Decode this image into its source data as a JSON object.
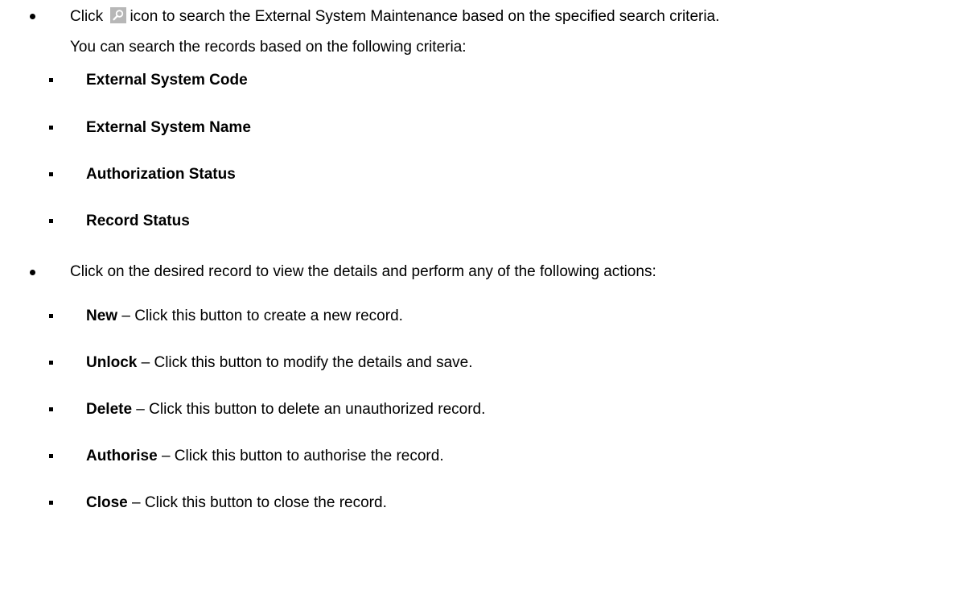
{
  "intro": {
    "click_word": "Click",
    "icon": "search-icon",
    "rest": "icon to search the External System Maintenance based on the specified search criteria.",
    "line2": "You can search the records based on the following criteria:"
  },
  "criteria": [
    "External System Code",
    "External System Name",
    "Authorization Status",
    "Record Status"
  ],
  "actions_intro": "Click on the desired record to view the details and perform any of the following actions:",
  "actions": [
    {
      "label": "New",
      "desc": " – Click this button to create a new record."
    },
    {
      "label": "Unlock",
      "desc": " – Click this button to modify the details and save."
    },
    {
      "label": "Delete",
      "desc": " – Click this button to delete an unauthorized record."
    },
    {
      "label": "Authorise",
      "desc": " – Click this button to authorise the record."
    },
    {
      "label": "Close",
      "desc": " – Click this button to close the record."
    }
  ]
}
